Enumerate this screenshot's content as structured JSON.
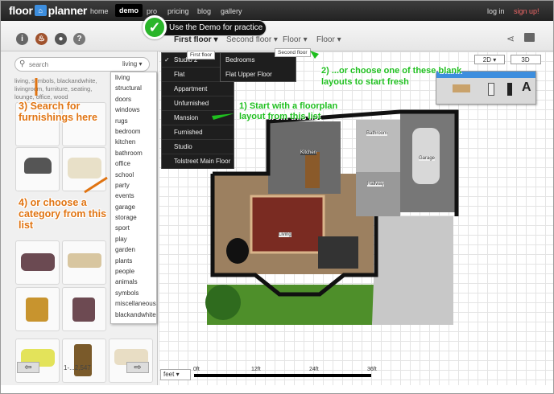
{
  "nav": {
    "logo_text": "floor",
    "logo_box": "⌂",
    "logo_text2": "planner",
    "items": [
      "home",
      "demo",
      "pro",
      "pricing",
      "blog",
      "gallery"
    ],
    "login": "log in",
    "signup": "sign up!"
  },
  "callout": {
    "text": "Use the Demo for practice",
    "check": "✓"
  },
  "toolbar": {
    "icons": [
      "info-icon",
      "fire-icon",
      "bomb-icon",
      "help-icon"
    ],
    "floors": [
      "First floor",
      "Second floor",
      "Floor",
      "Floor"
    ],
    "tooltip_first": "First floor",
    "tooltip_second": "Second floor"
  },
  "search": {
    "placeholder": "search",
    "category": "living",
    "tags": "living, symbols, blackandwhite, livingroom, furniture, seating, lounge, office, wood"
  },
  "categories": [
    "living",
    "structural",
    "doors",
    "windows",
    "rugs",
    "bedroom",
    "kitchen",
    "bathroom",
    "office",
    "school",
    "party",
    "events",
    "garage",
    "storage",
    "sport",
    "play",
    "garden",
    "plants",
    "people",
    "animals",
    "symbols",
    "miscellaneous",
    "blackandwhite"
  ],
  "floor_menu": [
    "Studio 2",
    "Flat",
    "Appartment",
    "Unfurnished",
    "Mansion",
    "Furnished",
    "Studio",
    "Tolstreet Main Floor"
  ],
  "floor_menu_checked": "✓",
  "submenu": [
    "Bedrooms",
    "Flat Upper Floor"
  ],
  "annotations": {
    "a1": "1) Start with a floorplan layout from this list",
    "a2": "2) ...or choose one of these blank layouts to start fresh",
    "a3": "3) Search for furnishings here",
    "a4": "4) or choose a category from this list"
  },
  "views": {
    "v2d": "2D ▾",
    "v3d": "3D"
  },
  "rooms": {
    "kitchen": "Kitchen",
    "bathroom": "Bathroom",
    "garage": "Garage",
    "hallway": "Hallway",
    "living": "Living"
  },
  "bottom": {
    "unit": "feet",
    "scale": [
      "0ft",
      "12ft",
      "24ft",
      "36ft"
    ],
    "counter": "1-...2,547"
  },
  "colors": {
    "accent_blue": "#3d8ede",
    "green": "#1fbf1f",
    "orange": "#e07412"
  }
}
